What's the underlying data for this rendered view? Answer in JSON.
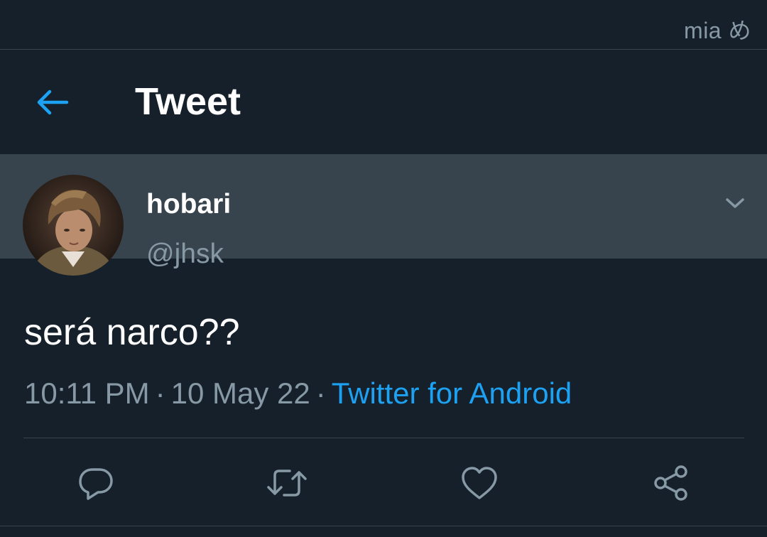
{
  "status_bar": {
    "text": "mia め"
  },
  "header": {
    "title": "Tweet",
    "back_icon": "arrow-left-icon",
    "accent": "#1da1f2"
  },
  "tweet": {
    "display_name": "hobari",
    "handle": "@jhsk",
    "text": "será narco??",
    "time": "10:11 PM",
    "date": "10 May 22",
    "separator": "·",
    "source": "Twitter for Android",
    "more_icon": "chevron-down-icon"
  },
  "actions": [
    {
      "name": "reply",
      "icon": "reply-icon"
    },
    {
      "name": "retweet",
      "icon": "retweet-icon"
    },
    {
      "name": "like",
      "icon": "heart-icon"
    },
    {
      "name": "share",
      "icon": "share-icon"
    }
  ],
  "colors": {
    "background": "#15202b",
    "divider": "#38444d",
    "secondary_text": "#8899a6",
    "link": "#1da1f2"
  }
}
